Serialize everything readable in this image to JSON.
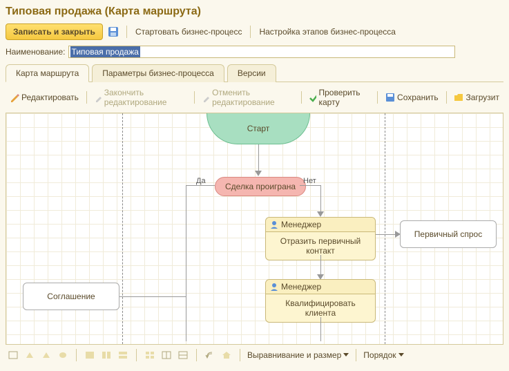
{
  "title": "Типовая продажа (Карта маршрута)",
  "mainToolbar": {
    "saveClose": "Записать и закрыть",
    "startBP": "Стартовать бизнес-процесс",
    "setupStages": "Настройка этапов бизнес-процесса"
  },
  "nameLabel": "Наименование:",
  "nameValue": "Типовая продажа",
  "tabs": {
    "route": "Карта маршрута",
    "params": "Параметры бизнес-процесса",
    "versions": "Версии"
  },
  "subToolbar": {
    "edit": "Редактировать",
    "finishEdit": "Закончить редактирование",
    "cancelEdit": "Отменить редактирование",
    "check": "Проверить карту",
    "save": "Сохранить",
    "load": "Загрузит"
  },
  "diagram": {
    "start": "Старт",
    "condition": "Сделка проиграна",
    "yes": "Да",
    "no": "Нет",
    "role": "Менеджер",
    "task1": "Отразить первичный контакт",
    "task2": "Квалифицировать клиента",
    "out1": "Первичный спрос",
    "out2": "Соглашение"
  },
  "bottomBar": {
    "align": "Выравнивание и размер",
    "order": "Порядок"
  }
}
